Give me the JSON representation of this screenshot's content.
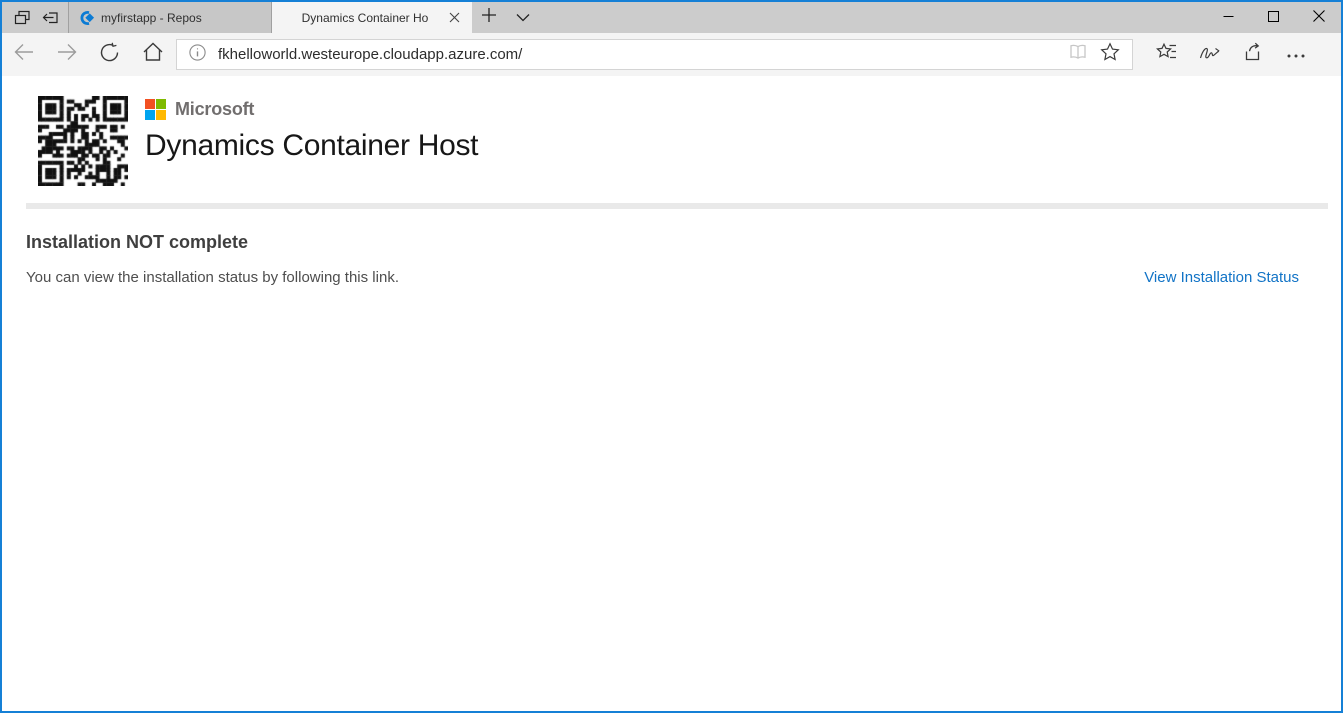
{
  "tab_bar": {
    "tabs": [
      {
        "title": "myfirstapp - Repos",
        "active": false
      },
      {
        "title": "Dynamics Container Ho",
        "active": true
      }
    ]
  },
  "address_bar": {
    "url": "fkhelloworld.westeurope.cloudapp.azure.com/"
  },
  "content": {
    "brand": "Microsoft",
    "page_title": "Dynamics Container Host",
    "status_heading": "Installation NOT complete",
    "status_message": "You can view the installation status by following this link.",
    "status_link": "View Installation Status"
  },
  "colors": {
    "accent_border": "#1580d6",
    "tab_bar_bg": "#cccccc",
    "toolbar_bg": "#f4f4f4",
    "link_blue": "#1173c6",
    "ms_red": "#f25022",
    "ms_green": "#7fba00",
    "ms_blue": "#00a4ef",
    "ms_yellow": "#ffb900"
  }
}
